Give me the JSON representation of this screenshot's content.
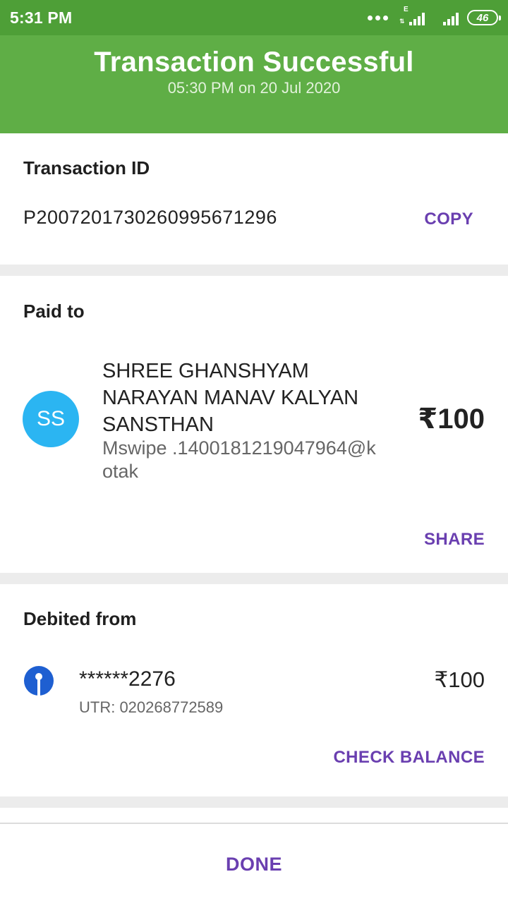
{
  "status_bar": {
    "time": "5:31 PM",
    "network_type": "E",
    "battery": "46"
  },
  "header": {
    "title": "Transaction Successful",
    "subtitle": "05:30 PM on 20 Jul 2020",
    "color": "#5fae46"
  },
  "transaction": {
    "label": "Transaction ID",
    "id": "P2007201730260995671296",
    "copy_label": "COPY"
  },
  "paid_to": {
    "label": "Paid to",
    "avatar_initials": "SS",
    "avatar_color": "#2bb5f2",
    "name": "SHREE GHANSHYAM NARAYAN MANAV KALYAN SANSTHAN",
    "vpa": "Mswipe .1400181219047964@kotak",
    "amount": "₹100",
    "share_label": "SHARE"
  },
  "debited_from": {
    "label": "Debited from",
    "bank_icon": "sbi-logo-icon",
    "account": "******2276",
    "utr": "UTR: 020268772589",
    "amount": "₹100",
    "check_balance_label": "CHECK BALANCE"
  },
  "footer": {
    "done_label": "DONE",
    "accent_color": "#6a3fb0"
  }
}
